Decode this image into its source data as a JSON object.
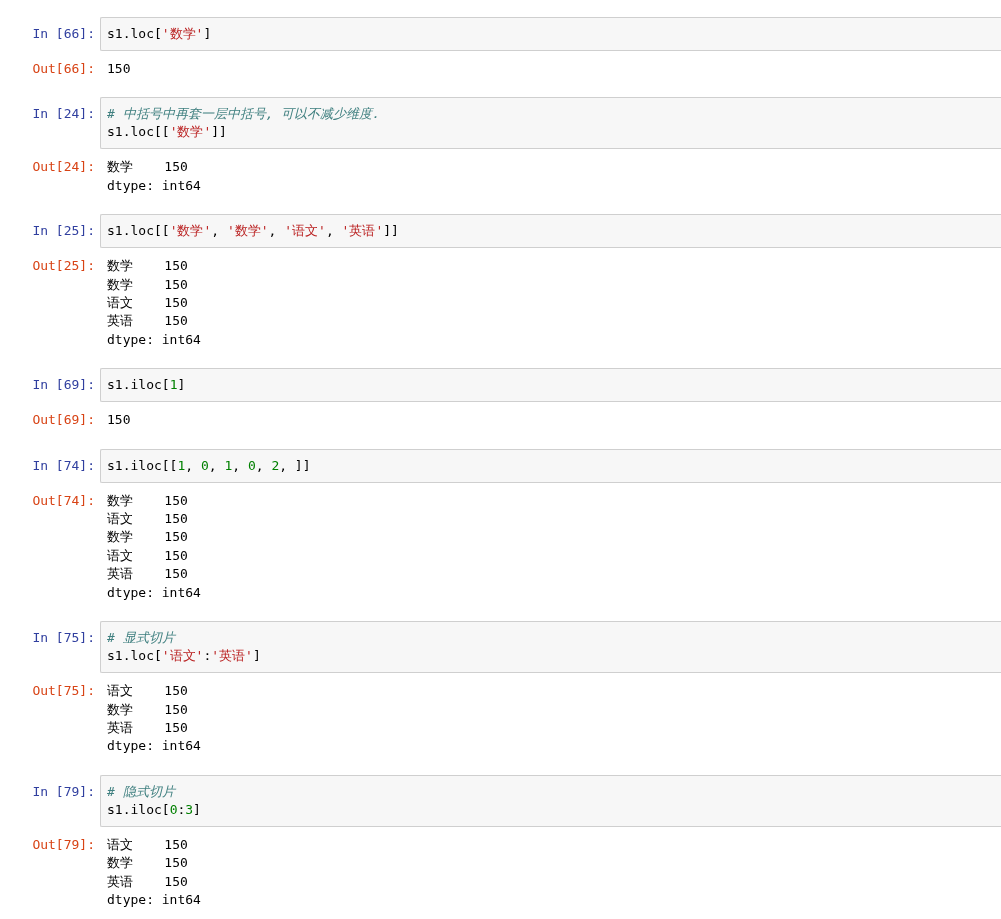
{
  "cells": [
    {
      "in_prompt": "In [66]:",
      "code": [
        [
          {
            "kind": "text",
            "t": "s1.loc["
          },
          {
            "kind": "string",
            "t": "'数学'"
          },
          {
            "kind": "text",
            "t": "]"
          }
        ]
      ],
      "out_prompt": "Out[66]:",
      "output": [
        "150"
      ]
    },
    {
      "in_prompt": "In [24]:",
      "code": [
        [
          {
            "kind": "comment",
            "t": "# 中括号中再套一层中括号, 可以不减少维度."
          }
        ],
        [
          {
            "kind": "text",
            "t": "s1.loc[["
          },
          {
            "kind": "string",
            "t": "'数学'"
          },
          {
            "kind": "text",
            "t": "]]"
          }
        ]
      ],
      "out_prompt": "Out[24]:",
      "output": [
        "数学    150",
        "dtype: int64"
      ]
    },
    {
      "in_prompt": "In [25]:",
      "code": [
        [
          {
            "kind": "text",
            "t": "s1.loc[["
          },
          {
            "kind": "string",
            "t": "'数学'"
          },
          {
            "kind": "text",
            "t": ", "
          },
          {
            "kind": "string",
            "t": "'数学'"
          },
          {
            "kind": "text",
            "t": ", "
          },
          {
            "kind": "string",
            "t": "'语文'"
          },
          {
            "kind": "text",
            "t": ", "
          },
          {
            "kind": "string",
            "t": "'英语'"
          },
          {
            "kind": "text",
            "t": "]]"
          }
        ]
      ],
      "out_prompt": "Out[25]:",
      "output": [
        "数学    150",
        "数学    150",
        "语文    150",
        "英语    150",
        "dtype: int64"
      ]
    },
    {
      "in_prompt": "In [69]:",
      "code": [
        [
          {
            "kind": "text",
            "t": "s1.iloc["
          },
          {
            "kind": "number",
            "t": "1"
          },
          {
            "kind": "text",
            "t": "]"
          }
        ]
      ],
      "out_prompt": "Out[69]:",
      "output": [
        "150"
      ]
    },
    {
      "in_prompt": "In [74]:",
      "code": [
        [
          {
            "kind": "text",
            "t": "s1.iloc[["
          },
          {
            "kind": "number",
            "t": "1"
          },
          {
            "kind": "text",
            "t": ", "
          },
          {
            "kind": "number",
            "t": "0"
          },
          {
            "kind": "text",
            "t": ", "
          },
          {
            "kind": "number",
            "t": "1"
          },
          {
            "kind": "text",
            "t": ", "
          },
          {
            "kind": "number",
            "t": "0"
          },
          {
            "kind": "text",
            "t": ", "
          },
          {
            "kind": "number",
            "t": "2"
          },
          {
            "kind": "text",
            "t": ", ]]"
          }
        ]
      ],
      "out_prompt": "Out[74]:",
      "output": [
        "数学    150",
        "语文    150",
        "数学    150",
        "语文    150",
        "英语    150",
        "dtype: int64"
      ]
    },
    {
      "in_prompt": "In [75]:",
      "code": [
        [
          {
            "kind": "comment",
            "t": "# 显式切片"
          }
        ],
        [
          {
            "kind": "text",
            "t": "s1.loc["
          },
          {
            "kind": "string",
            "t": "'语文'"
          },
          {
            "kind": "text",
            "t": ":"
          },
          {
            "kind": "string",
            "t": "'英语'"
          },
          {
            "kind": "text",
            "t": "]"
          }
        ]
      ],
      "out_prompt": "Out[75]:",
      "output": [
        "语文    150",
        "数学    150",
        "英语    150",
        "dtype: int64"
      ]
    },
    {
      "in_prompt": "In [79]:",
      "code": [
        [
          {
            "kind": "comment",
            "t": "# 隐式切片"
          }
        ],
        [
          {
            "kind": "text",
            "t": "s1.iloc["
          },
          {
            "kind": "number",
            "t": "0"
          },
          {
            "kind": "text",
            "t": ":"
          },
          {
            "kind": "number",
            "t": "3"
          },
          {
            "kind": "text",
            "t": "]"
          }
        ]
      ],
      "out_prompt": "Out[79]:",
      "output": [
        "语文    150",
        "数学    150",
        "英语    150",
        "dtype: int64"
      ]
    }
  ]
}
